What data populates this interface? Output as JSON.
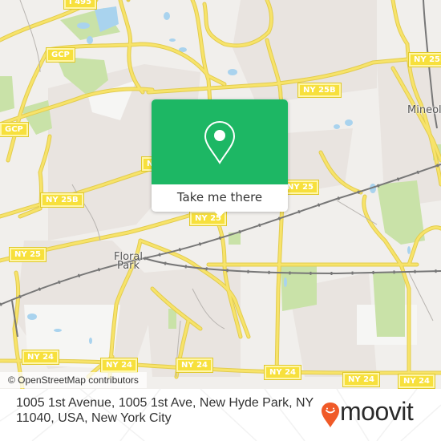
{
  "map": {
    "colors": {
      "land": "#f1efec",
      "urban": "#e8e2de",
      "park": "#c9e2a8",
      "water": "#a9d3ee",
      "road": "#f7e36a",
      "road_casing": "#e2cc4f",
      "rail": "#777777"
    },
    "route_shields": [
      {
        "label": "I 495"
      },
      {
        "label": "GCP"
      },
      {
        "label": "GCP"
      },
      {
        "label": "NY 25B"
      },
      {
        "label": "NY 25B"
      },
      {
        "label": "NY 25B"
      },
      {
        "label": "NY 25B"
      },
      {
        "label": "NY 25"
      },
      {
        "label": "NY 25"
      },
      {
        "label": "NY 25"
      },
      {
        "label": "NY 24"
      },
      {
        "label": "NY 24"
      },
      {
        "label": "NY 24"
      },
      {
        "label": "NY 24"
      },
      {
        "label": "NY 24"
      },
      {
        "label": "NY 24"
      }
    ],
    "place_labels": [
      {
        "label": "Mineola"
      },
      {
        "label": "Floral Park"
      }
    ],
    "attribution": "© OpenStreetMap contributors"
  },
  "popup": {
    "icon": "map-pin-icon",
    "button_label": "Take me there",
    "accent_color": "#1db764"
  },
  "footer": {
    "address": "1005 1st Avenue, 1005 1st Ave, New Hyde Park, NY 11040, USA, New York City",
    "brand": "moovit",
    "brand_icon": "moovit-smile-pin-icon",
    "brand_color": "#f05a28"
  }
}
